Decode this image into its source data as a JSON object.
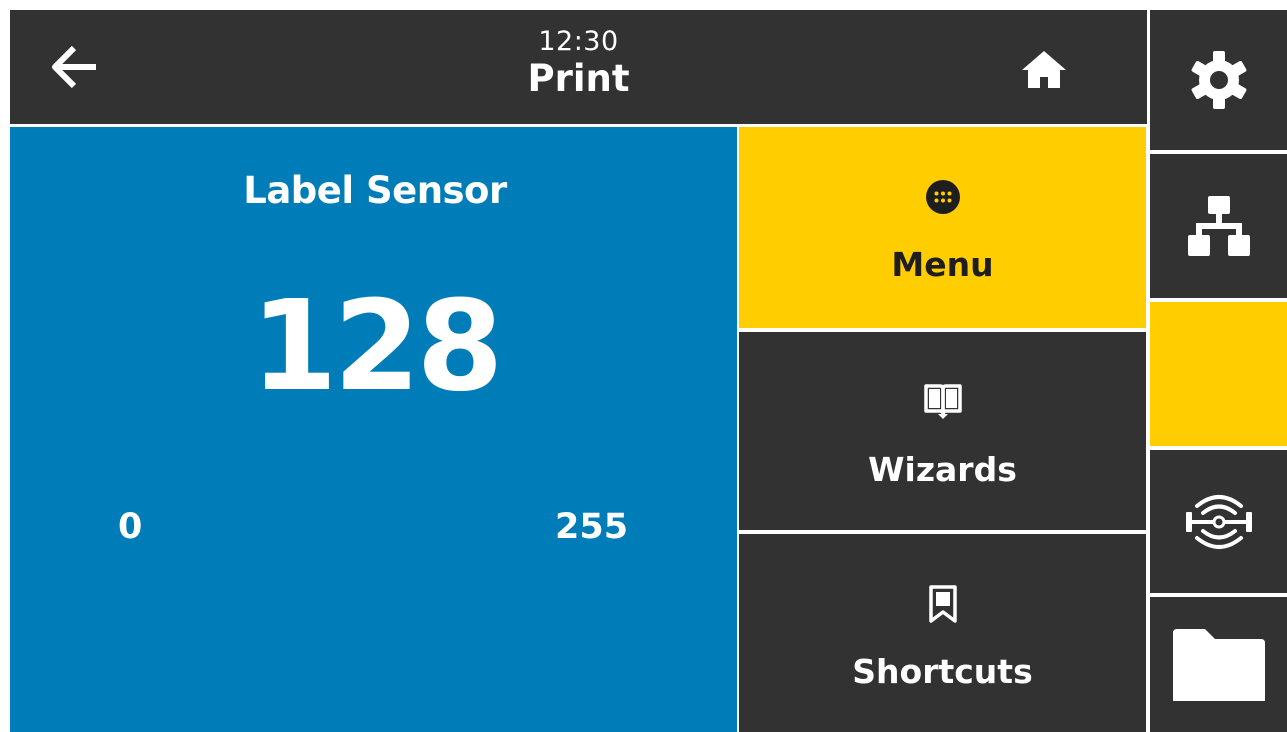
{
  "header": {
    "time": "12:30",
    "title": "Print",
    "icons": {
      "back": "arrow-left-icon",
      "home": "home-icon"
    }
  },
  "sensor": {
    "title": "Label Sensor",
    "value": "128",
    "min": "0",
    "max": "255"
  },
  "tiles": [
    {
      "label": "Menu",
      "icon": "dots-grid-icon"
    },
    {
      "label": "Wizards",
      "icon": "open-book-icon"
    },
    {
      "label": "Shortcuts",
      "icon": "bookmark-icon"
    }
  ],
  "sidebar": {
    "items": [
      {
        "icon": "gear-icon"
      },
      {
        "icon": "network-icon"
      },
      {
        "icon": ""
      },
      {
        "icon": "rfid-icon"
      },
      {
        "icon": "folder-icon"
      }
    ]
  },
  "colors": {
    "header_bg": "#323232",
    "panel_blue": "#007db8",
    "accent_yellow": "#ffcd00",
    "tile_dark": "#323232",
    "text_light": "#ffffff",
    "text_dark": "#1e1e1e"
  }
}
